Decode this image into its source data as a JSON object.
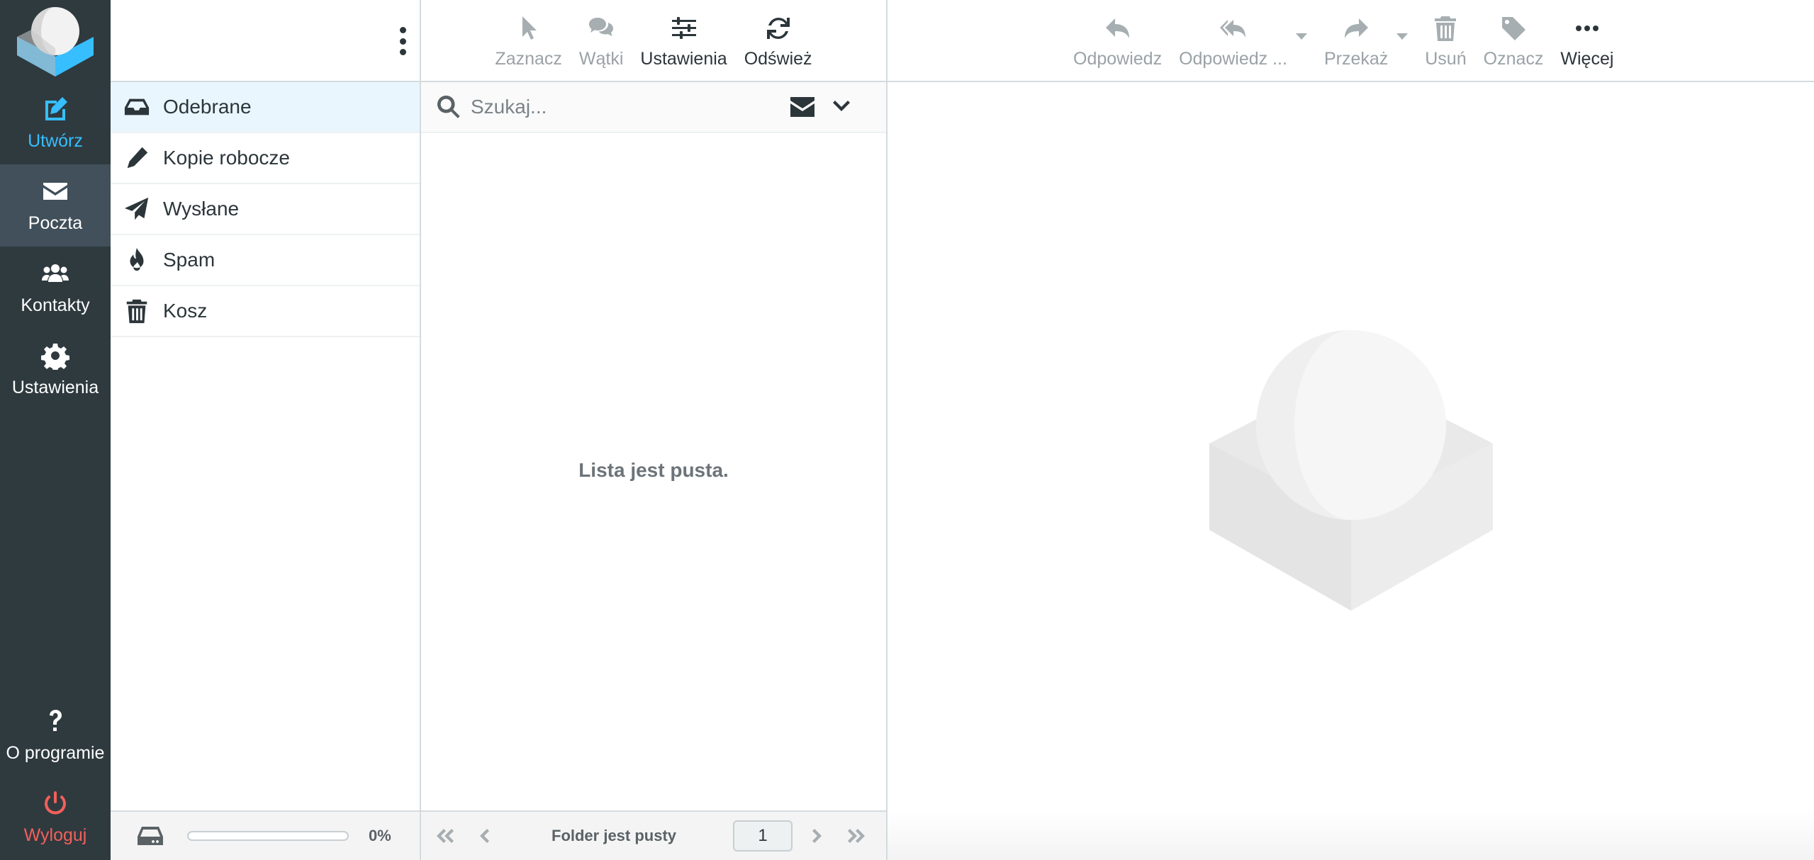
{
  "nav": {
    "compose": "Utwórz",
    "mail": "Poczta",
    "contacts": "Kontakty",
    "settings": "Ustawienia",
    "about": "O programie",
    "logout": "Wyloguj"
  },
  "folders": [
    {
      "label": "Odebrane",
      "icon": "inbox-icon",
      "selected": true
    },
    {
      "label": "Kopie robocze",
      "icon": "pencil-icon",
      "selected": false
    },
    {
      "label": "Wysłane",
      "icon": "paper-plane-icon",
      "selected": false
    },
    {
      "label": "Spam",
      "icon": "fire-icon",
      "selected": false
    },
    {
      "label": "Kosz",
      "icon": "trash-icon",
      "selected": false
    }
  ],
  "quota": {
    "text": "0%",
    "percent": 0
  },
  "list_toolbar": {
    "select": "Zaznacz",
    "threads": "Wątki",
    "options": "Ustawienia",
    "refresh": "Odśwież"
  },
  "search": {
    "placeholder": "Szukaj..."
  },
  "list": {
    "empty_text": "Lista jest pusta.",
    "folder_status": "Folder jest pusty",
    "page": "1"
  },
  "content_toolbar": {
    "reply": "Odpowiedz",
    "reply_all": "Odpowiedz ...",
    "forward": "Przekaż",
    "delete": "Usuń",
    "mark": "Oznacz",
    "more": "Więcej"
  },
  "colors": {
    "nav_bg": "#2f3a3f",
    "nav_selected_bg": "#41505a",
    "accent": "#37beff",
    "logout": "#f2605b",
    "selected_folder_bg": "#e9f6fd"
  }
}
